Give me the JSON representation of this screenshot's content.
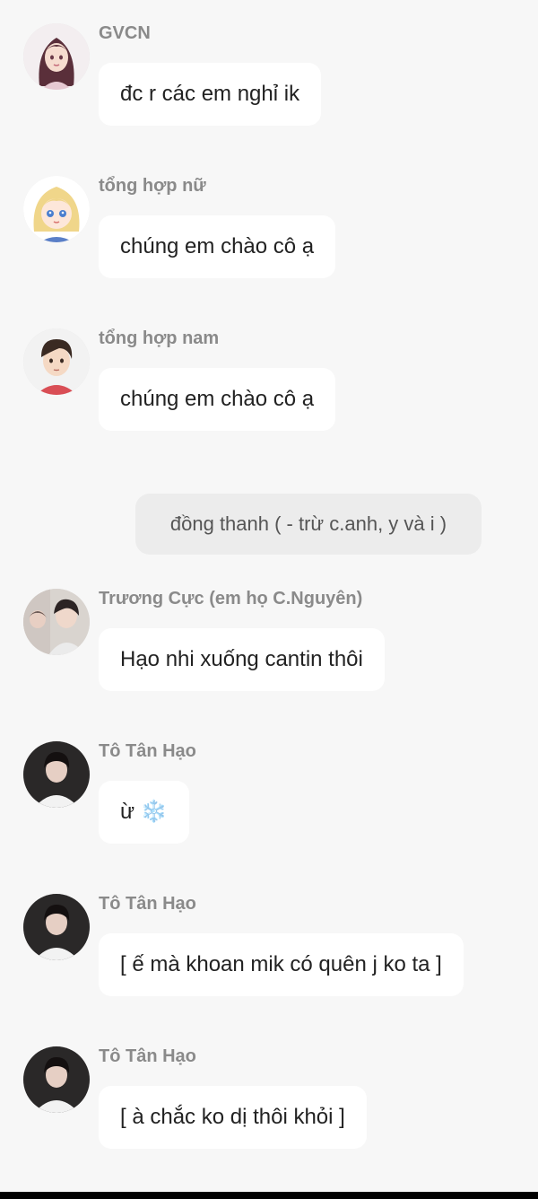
{
  "messages": [
    {
      "sender": "GVCN",
      "text": "đc r các em nghỉ ik",
      "avatar": "female-teacher-avatar"
    },
    {
      "sender": "tổng hợp nữ",
      "text": "chúng em chào cô ạ",
      "avatar": "blonde-girl-avatar"
    },
    {
      "sender": "tổng hợp nam",
      "text": "chúng em chào cô ạ",
      "avatar": "boy-avatar"
    },
    {
      "sender": "Trương Cực (em họ C.Nguyên)",
      "text": "Hạo nhi xuống cantin thôi",
      "avatar": "photo-avatar"
    },
    {
      "sender": "Tô Tân Hạo",
      "text": "ừ ❄️",
      "avatar": "photo-avatar-dark"
    },
    {
      "sender": "Tô Tân Hạo",
      "text": "[ ế mà khoan mik có quên j ko ta ]",
      "avatar": "photo-avatar-dark"
    },
    {
      "sender": "Tô Tân Hạo",
      "text": "[ à chắc ko dị thôi khỏi ]",
      "avatar": "photo-avatar-dark"
    }
  ],
  "narration": "đồng thanh ( - trừ c.anh, y và i )"
}
